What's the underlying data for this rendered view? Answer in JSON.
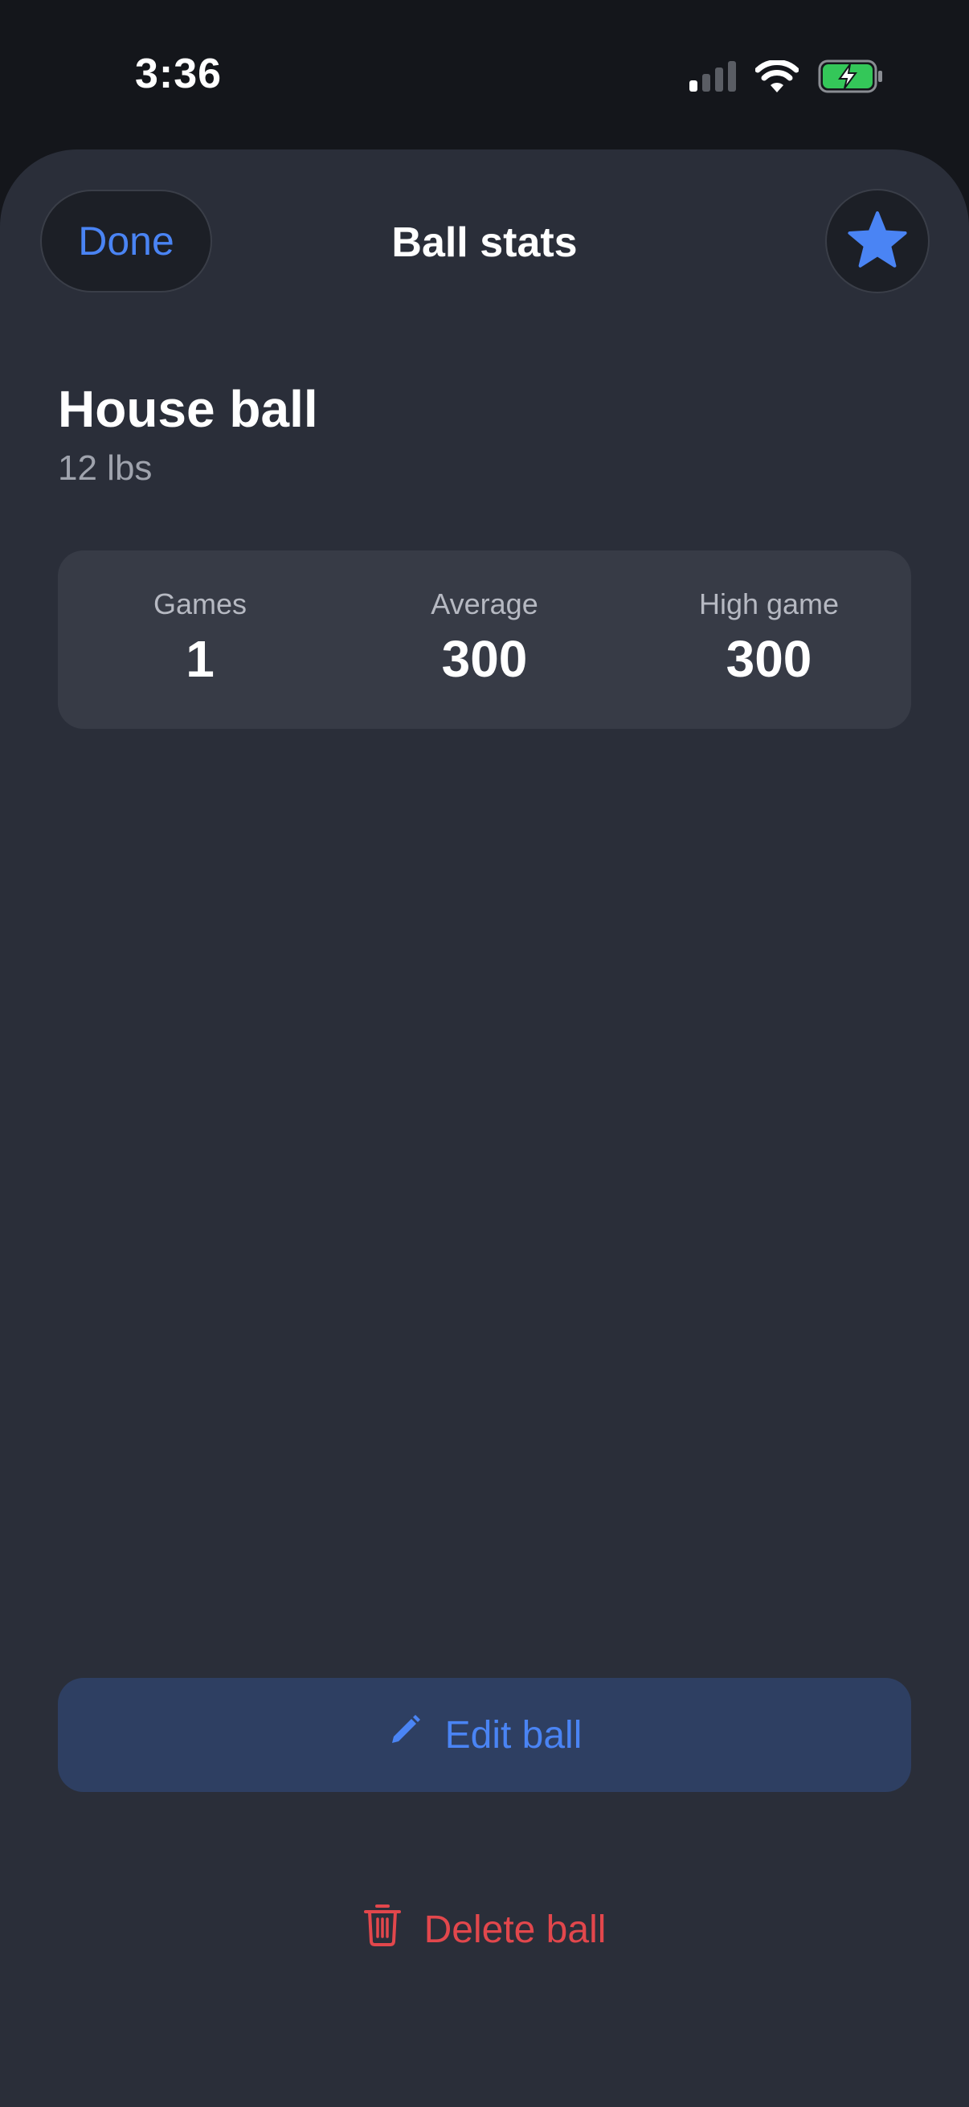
{
  "status_bar": {
    "time": "3:36",
    "icons": [
      "cellular-signal-icon",
      "wifi-icon",
      "battery-charging-icon"
    ]
  },
  "header": {
    "done_label": "Done",
    "title": "Ball stats",
    "favorite_icon": "star-icon"
  },
  "ball": {
    "name": "House ball",
    "weight": "12 lbs"
  },
  "stats": [
    {
      "label": "Games",
      "value": "1"
    },
    {
      "label": "Average",
      "value": "300"
    },
    {
      "label": "High game",
      "value": "300"
    }
  ],
  "actions": {
    "edit_label": "Edit ball",
    "edit_icon": "pencil-icon",
    "delete_label": "Delete ball",
    "delete_icon": "trash-icon"
  },
  "colors": {
    "accent": "#4a84f4",
    "destructive": "#e2474c",
    "battery": "#34c759",
    "background": "#2a2e39"
  }
}
